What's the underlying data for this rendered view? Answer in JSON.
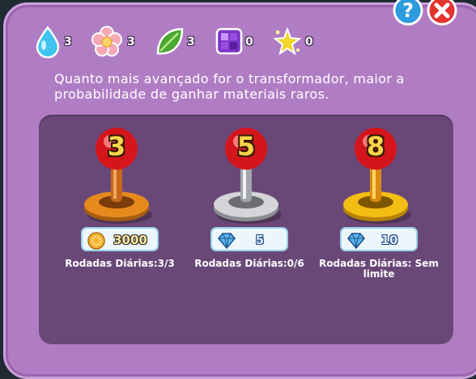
{
  "resources": [
    {
      "icon": "water-drop-icon",
      "count": "3"
    },
    {
      "icon": "flower-icon",
      "count": "3"
    },
    {
      "icon": "leaf-icon",
      "count": "3"
    },
    {
      "icon": "purple-cube-icon",
      "count": "0"
    },
    {
      "icon": "star-sparkle-icon",
      "count": "0"
    }
  ],
  "description": "Quanto mais avançado for o transformador, maior a probabilidade de ganhar materiais raros.",
  "transformers": [
    {
      "level": "3",
      "price": "3000",
      "currency": "coin-icon",
      "rounds": "Rodadas Diárias:3/3",
      "base_color": "#e78a1d"
    },
    {
      "level": "5",
      "price": "5",
      "currency": "diamond-icon",
      "rounds": "Rodadas Diárias:0/6",
      "base_color": "#c7c9cc"
    },
    {
      "level": "8",
      "price": "10",
      "currency": "diamond-icon",
      "rounds": "Rodadas Diárias: Sem limite",
      "base_color": "#f2b914"
    }
  ],
  "help_icon": "help-icon",
  "close_icon": "close-icon"
}
